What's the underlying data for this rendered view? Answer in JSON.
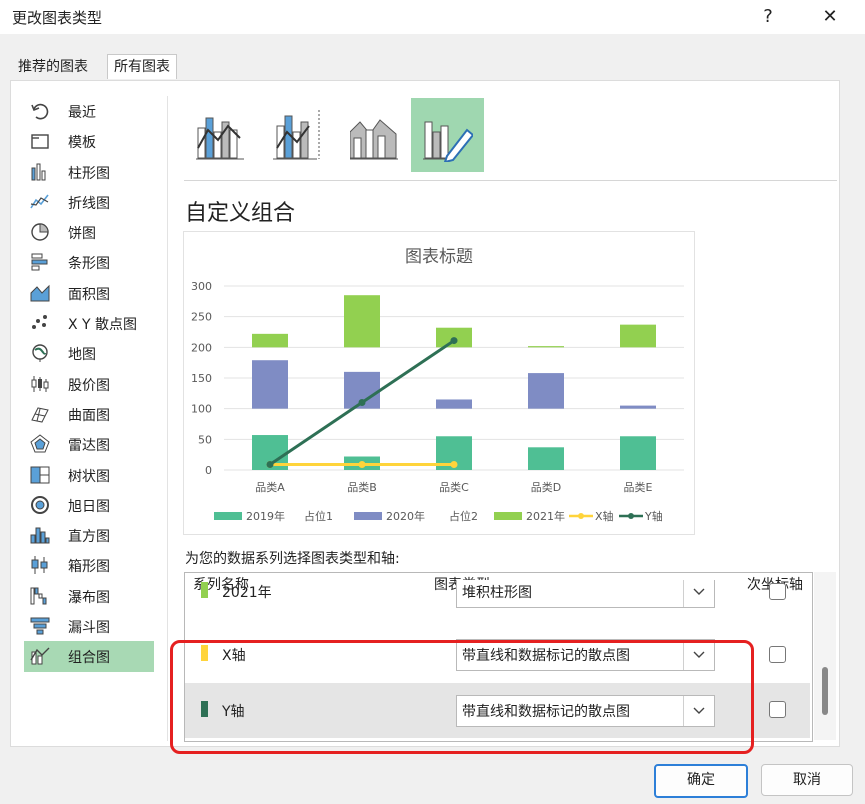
{
  "dialog": {
    "title": "更改图表类型",
    "help": "?",
    "close": "✕"
  },
  "tabs": [
    "推荐的图表",
    "所有图表"
  ],
  "categories": [
    "最近",
    "模板",
    "柱形图",
    "折线图",
    "饼图",
    "条形图",
    "面积图",
    "X Y 散点图",
    "地图",
    "股价图",
    "曲面图",
    "雷达图",
    "树状图",
    "旭日图",
    "直方图",
    "箱形图",
    "瀑布图",
    "漏斗图",
    "组合图"
  ],
  "selected_category": "组合图",
  "combo_section_title": "自定义组合",
  "series_prompt": "为您的数据系列选择图表类型和轴:",
  "series_table": {
    "headers": {
      "name": "系列名称",
      "type": "图表类型",
      "secondary": "次坐标轴"
    },
    "rows": [
      {
        "name": "2021年",
        "type": "堆积柱形图",
        "color": "#92d050",
        "checked": false
      },
      {
        "name": "X轴",
        "type": "带直线和数据标记的散点图",
        "color": "#ffd43b",
        "checked": false
      },
      {
        "name": "Y轴",
        "type": "带直线和数据标记的散点图",
        "color": "#2e7055",
        "checked": false
      }
    ]
  },
  "buttons": {
    "ok": "确定",
    "cancel": "取消"
  },
  "colors": {
    "green_dark": "#4fbf94",
    "purple": "#7f8cc4",
    "lime": "#92d050",
    "yellow": "#ffd43b",
    "teal_dark": "#2e7055",
    "highlight": "#e52020",
    "selected": "#a8d9b4"
  },
  "chart_data": {
    "type": "bar",
    "title": "图表标题",
    "categories": [
      "品类A",
      "品类B",
      "品类C",
      "品类D",
      "品类E"
    ],
    "ylim": [
      0,
      300
    ],
    "yticks": [
      0,
      50,
      100,
      150,
      200,
      250,
      300
    ],
    "stacked": true,
    "series": [
      {
        "name": "2019年",
        "values": [
          57,
          22,
          55,
          37,
          55
        ],
        "color": "#4fbf94"
      },
      {
        "name": "占位1",
        "values": [
          43,
          78,
          45,
          63,
          45
        ],
        "color": "none"
      },
      {
        "name": "2020年",
        "values": [
          79,
          60,
          15,
          58,
          5
        ],
        "color": "#7f8cc4"
      },
      {
        "name": "占位2",
        "values": [
          21,
          40,
          85,
          42,
          95
        ],
        "color": "none"
      },
      {
        "name": "2021年",
        "values": [
          22,
          85,
          32,
          2,
          37
        ],
        "color": "#92d050"
      }
    ],
    "lines": [
      {
        "name": "X轴",
        "points": [
          [
            0,
            9
          ],
          [
            1,
            9
          ],
          [
            2,
            9
          ]
        ],
        "color": "#ffd43b"
      },
      {
        "name": "Y轴",
        "points": [
          [
            0,
            9
          ],
          [
            1,
            110
          ],
          [
            2,
            211
          ]
        ],
        "color": "#2e7055"
      }
    ],
    "legend": [
      {
        "name": "2019年",
        "kind": "box",
        "color": "#4fbf94"
      },
      {
        "name": "占位1",
        "kind": "none",
        "color": ""
      },
      {
        "name": "2020年",
        "kind": "box",
        "color": "#7f8cc4"
      },
      {
        "name": "占位2",
        "kind": "none",
        "color": ""
      },
      {
        "name": "2021年",
        "kind": "box",
        "color": "#92d050"
      },
      {
        "name": "X轴",
        "kind": "line",
        "color": "#ffd43b"
      },
      {
        "name": "Y轴",
        "kind": "line",
        "color": "#2e7055"
      }
    ],
    "legend_position": "bottom",
    "grid": true
  }
}
